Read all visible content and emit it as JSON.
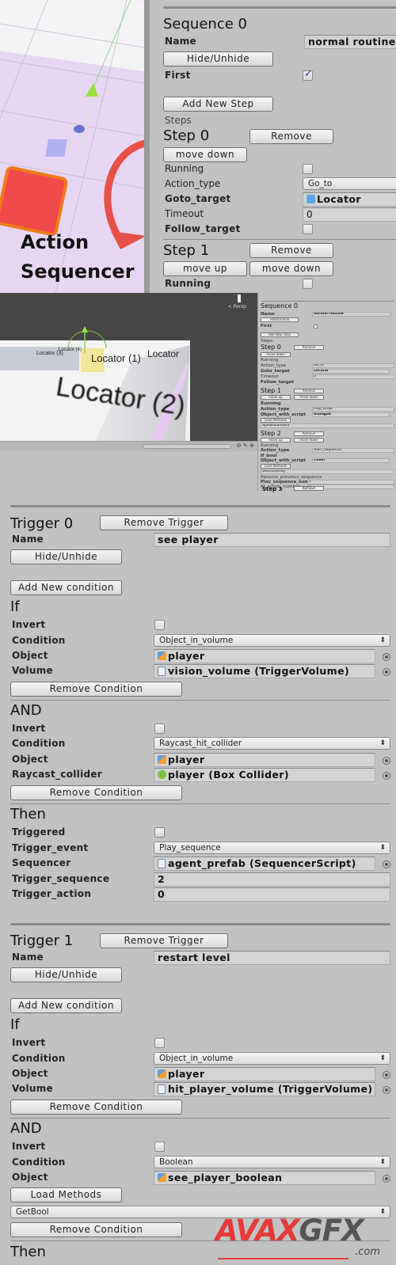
{
  "caption": {
    "line1": "Action",
    "line2": "Sequencer"
  },
  "sequence_inspector": {
    "title": "Sequence 0",
    "name_label": "Name",
    "name_value": "normal routine",
    "hide_button": "Hide/Unhide",
    "first_label": "First",
    "first_checked": true,
    "add_step_button": "Add New Step",
    "steps_label": "Steps",
    "steps": [
      {
        "title": "Step 0",
        "remove_button": "Remove",
        "move_down_button": "move down",
        "running_label": "Running",
        "running_checked": false,
        "action_type_label": "Action_type",
        "action_type_value": "Go_to",
        "goto_target_label": "Goto_target",
        "goto_target_value": "Locator",
        "timeout_label": "Timeout",
        "timeout_value": "0",
        "follow_target_label": "Follow_target",
        "follow_target_checked": false
      },
      {
        "title": "Step 1",
        "remove_button": "Remove",
        "move_up_button": "move up",
        "move_down_button": "move down",
        "running_label": "Running",
        "running_checked": false
      }
    ]
  },
  "scene_view": {
    "labels": [
      "Locator (3)",
      "Locator (4)",
      "Locator (1)",
      "Locator",
      "Locator (2)"
    ],
    "persp_label": "< Persp"
  },
  "mini_inspector": {
    "title": "Sequence 0",
    "name_label": "Name",
    "name_value": "normal routine",
    "hide_button": "Hide/Unhide",
    "first_label": "First",
    "add_step_button": "Add New Step",
    "steps_label": "Steps",
    "step0": {
      "title": "Step 0",
      "remove": "Remove",
      "move_down": "move down",
      "running": "Running",
      "action_type": "Action_type",
      "action_type_value": "Go_to",
      "goto_target": "Goto_target",
      "goto_target_value": "Locator",
      "timeout": "Timeout",
      "timeout_value": "0",
      "follow_target": "Follow_target"
    },
    "step1": {
      "title": "Step 1",
      "remove": "Remove",
      "move_up": "move up",
      "move_down": "move down",
      "running": "Running",
      "action_type": "Action_type",
      "action_type_value": "Play_script",
      "object_with_script": "Object_with_script",
      "object_value": "dialogue",
      "load_methods": "Load Methods",
      "method_value": "SpeakStandard"
    },
    "step2": {
      "title": "Step 2",
      "remove": "Remove",
      "move_up": "move up",
      "move_down": "move down",
      "running": "Running",
      "action_type": "Action_type",
      "action_type_value": "Start_sequence",
      "if_bool": "If_bool",
      "object_with_script": "Object_with_script",
      "object_value": "Chest",
      "load_methods": "Load Methods",
      "method_value": "GetIsOverlay",
      "resume_previous": "Resume_previous_sequence",
      "play_sequence_number": "Play_sequence_number",
      "play_sequence_value": "1",
      "at_action_number": "At_action_number",
      "at_action_value": "0"
    },
    "step3": {
      "title": "Step 3",
      "remove": "Remove"
    }
  },
  "triggers": [
    {
      "title": "Trigger 0",
      "remove_button": "Remove Trigger",
      "name_label": "Name",
      "name_value": "see player",
      "hide_button": "Hide/Unhide",
      "add_condition_button": "Add New condition",
      "conditions": [
        {
          "heading": "If",
          "invert_label": "Invert",
          "invert_checked": false,
          "condition_label": "Condition",
          "condition_value": "Object_in_volume",
          "rows": [
            {
              "label": "Object",
              "value": "player",
              "icon": "gameobject-icon"
            },
            {
              "label": "Volume",
              "value": "vision_volume (TriggerVolume)",
              "icon": "script-icon"
            }
          ],
          "remove_button": "Remove Condition"
        },
        {
          "heading": "AND",
          "invert_label": "Invert",
          "invert_checked": false,
          "condition_label": "Condition",
          "condition_value": "Raycast_hit_collider",
          "rows": [
            {
              "label": "Object",
              "value": "player",
              "icon": "gameobject-icon"
            },
            {
              "label": "Raycast_collider",
              "value": "player (Box Collider)",
              "icon": "collider-icon"
            }
          ],
          "remove_button": "Remove Condition"
        }
      ],
      "then": {
        "heading": "Then",
        "triggered_label": "Triggered",
        "triggered_checked": false,
        "trigger_event_label": "Trigger_event",
        "trigger_event_value": "Play_sequence",
        "sequencer_label": "Sequencer",
        "sequencer_value": "agent_prefab (SequencerScript)",
        "trigger_sequence_label": "Trigger_sequence",
        "trigger_sequence_value": "2",
        "trigger_action_label": "Trigger_action",
        "trigger_action_value": "0"
      }
    },
    {
      "title": "Trigger 1",
      "remove_button": "Remove Trigger",
      "name_label": "Name",
      "name_value": "restart level",
      "hide_button": "Hide/Unhide",
      "add_condition_button": "Add New condition",
      "conditions": [
        {
          "heading": "If",
          "invert_label": "Invert",
          "invert_checked": false,
          "condition_label": "Condition",
          "condition_value": "Object_in_volume",
          "rows": [
            {
              "label": "Object",
              "value": "player",
              "icon": "gameobject-icon"
            },
            {
              "label": "Volume",
              "value": "hit_player_volume (TriggerVolume)",
              "icon": "script-icon"
            }
          ],
          "remove_button": "Remove Condition"
        },
        {
          "heading": "AND",
          "invert_label": "Invert",
          "invert_checked": false,
          "condition_label": "Condition",
          "condition_value": "Boolean",
          "rows": [
            {
              "label": "Object",
              "value": "see_player_boolean",
              "icon": "gameobject-icon"
            }
          ],
          "load_methods_button": "Load Methods",
          "method_value": "GetBool",
          "remove_button": "Remove Condition"
        }
      ],
      "then": {
        "heading": "Then"
      }
    }
  ],
  "watermark": {
    "brand_red": "AVAX",
    "brand_dark": "GFX",
    "domain": ".com"
  },
  "colors": {
    "panel_bg": "#c2c2c2",
    "check_blue": "#1f3f8a",
    "watermark_red": "#e63a3a",
    "arrow_red": "#e8504a"
  }
}
